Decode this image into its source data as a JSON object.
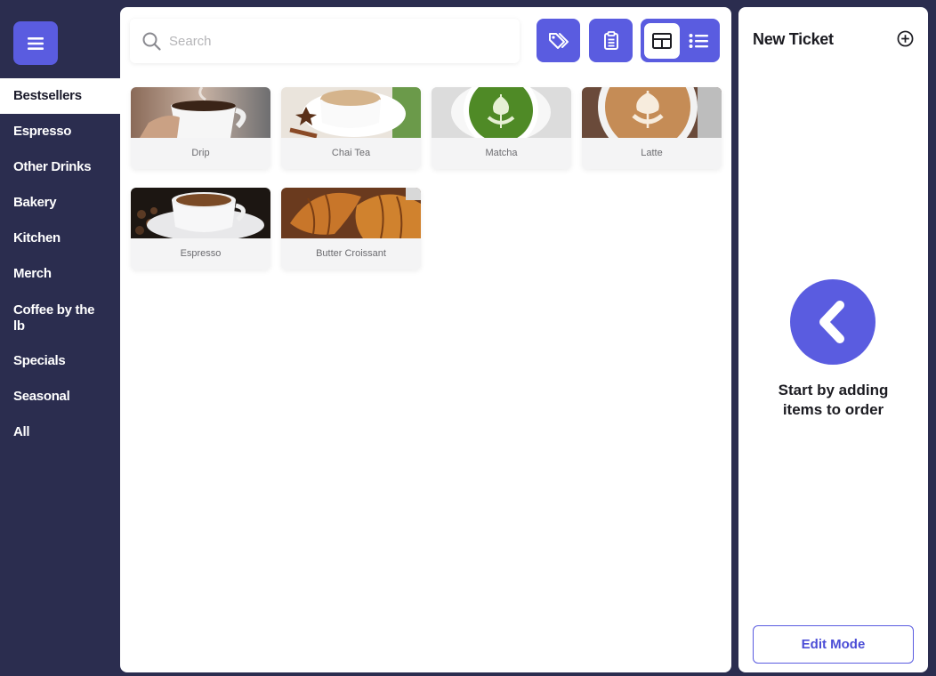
{
  "sidebar": {
    "menu_icon": "hamburger-icon",
    "categories": [
      {
        "label": "Bestsellers",
        "active": true
      },
      {
        "label": "Espresso"
      },
      {
        "label": "Other Drinks"
      },
      {
        "label": "Bakery"
      },
      {
        "label": "Kitchen"
      },
      {
        "label": "Merch"
      },
      {
        "label": "Coffee by the lb"
      },
      {
        "label": "Specials"
      },
      {
        "label": "Seasonal"
      },
      {
        "label": "All"
      }
    ]
  },
  "toolbar": {
    "search_placeholder": "Search",
    "search_value": "",
    "icons": [
      "search-icon",
      "tag-icon",
      "clipboard-icon",
      "grid-view-icon",
      "list-view-icon"
    ],
    "active_view": "grid"
  },
  "products": [
    {
      "name": "Drip"
    },
    {
      "name": "Chai Tea"
    },
    {
      "name": "Matcha"
    },
    {
      "name": "Latte"
    },
    {
      "name": "Espresso"
    },
    {
      "name": "Butter Croissant"
    }
  ],
  "ticket": {
    "title": "New Ticket",
    "empty_message": "Start by adding items to order",
    "edit_label": "Edit Mode"
  },
  "colors": {
    "accent": "#5a5ce0",
    "sidebar_bg": "#2b2d4f",
    "panel_bg": "#ffffff"
  }
}
